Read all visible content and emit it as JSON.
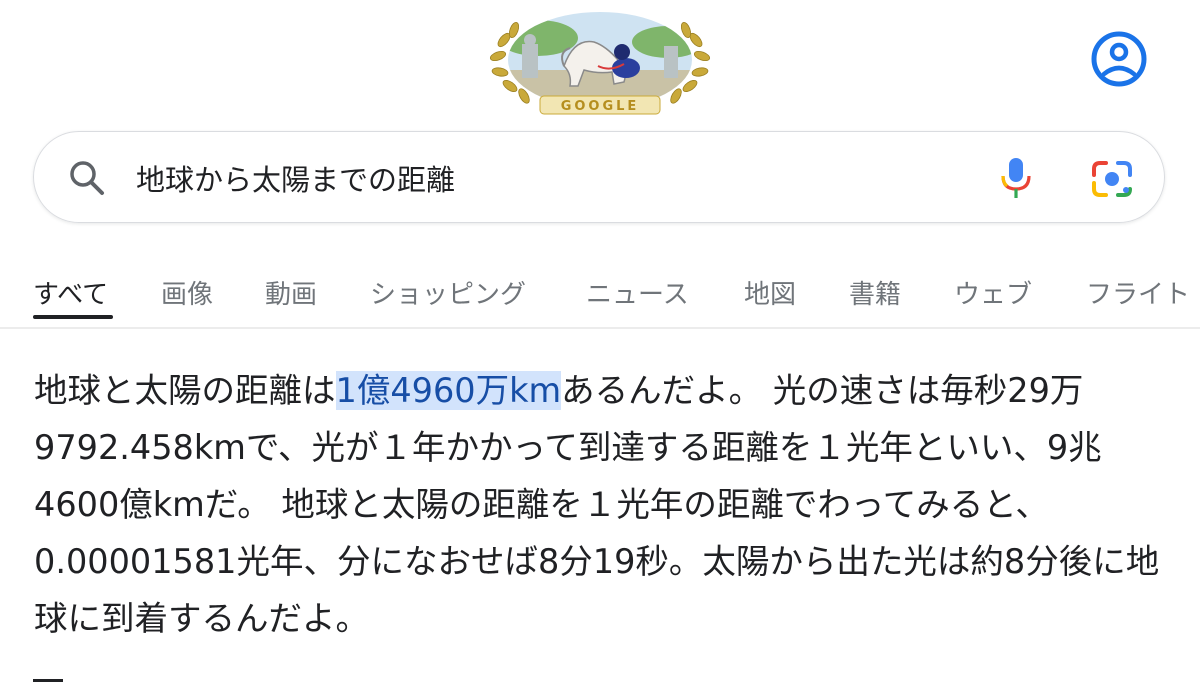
{
  "doodle": {
    "name": "google-doodle",
    "lettering": "GOOGLE"
  },
  "search": {
    "query": "地球から太陽までの距離",
    "icons": [
      "search-icon",
      "microphone-icon",
      "google-lens-icon"
    ]
  },
  "account": {
    "icon": "account-circle-icon"
  },
  "tabs": [
    {
      "label": "すべて",
      "active": true
    },
    {
      "label": "画像"
    },
    {
      "label": "動画"
    },
    {
      "label": "ショッピング"
    },
    {
      "label": "ニュース"
    },
    {
      "label": "地図"
    },
    {
      "label": "書籍"
    },
    {
      "label": "ウェブ"
    },
    {
      "label": "フライト"
    }
  ],
  "answer": {
    "before": "地球と太陽の距離は",
    "highlight": "1億4960万km",
    "after": "あるんだよ。 光の速さは毎秒29万9792.458kmで、光が１年かかって到達する距離を１光年といい、9兆4600億kmだ。 地球と太陽の距離を１光年の距離でわってみると、0.00001581光年、分になおせば8分19秒。太陽から出た光は約8分後に地球に到着するんだよ。"
  },
  "colors": {
    "accent_blue": "#1a73e8",
    "highlight_bg": "#d2e3fc",
    "highlight_text": "#174ea6",
    "text": "#202124",
    "muted": "#70757a"
  }
}
